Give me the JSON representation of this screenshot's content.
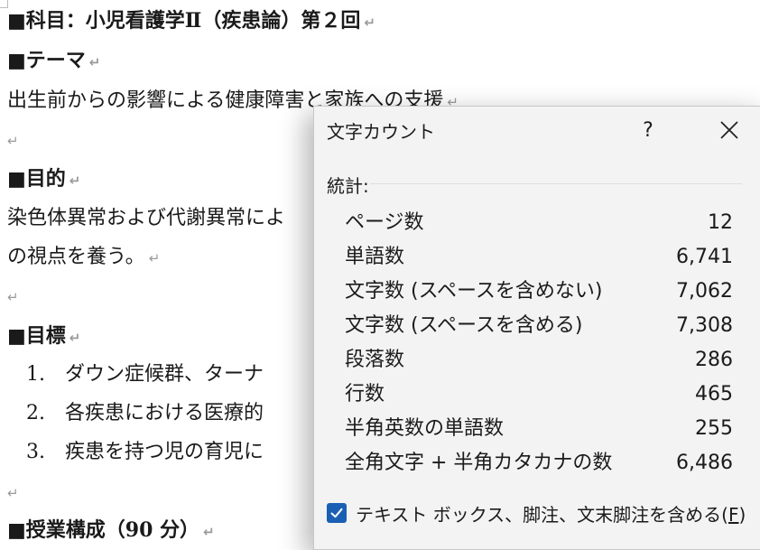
{
  "document": {
    "subject_heading": "■科目：小児看護学Ⅱ（疾患論）第２回",
    "theme_heading": "■テーマ",
    "theme_text": "出生前からの影響による健康障害と家族への支援",
    "purpose_heading": "■目的",
    "purpose_text_1": "染色体異常および代謝異常によ",
    "purpose_text_2": "の視点を養う。",
    "goals_heading": "■目標",
    "goals": [
      {
        "num": "1.",
        "text": "ダウン症候群、ターナ"
      },
      {
        "num": "2.",
        "text": "各疾患における医療的"
      },
      {
        "num": "3.",
        "text": "疾患を持つ児の育児に"
      }
    ],
    "structure_heading": "■授業構成（90 分）",
    "paragraph_mark": "↵"
  },
  "dialog": {
    "title": "文字カウント",
    "help_label": "?",
    "section_label": "統計:",
    "stats": [
      {
        "label": "ページ数",
        "value": "12"
      },
      {
        "label": "単語数",
        "value": "6,741"
      },
      {
        "label": "文字数 (スペースを含めない)",
        "value": "7,062"
      },
      {
        "label": "文字数 (スペースを含める)",
        "value": "7,308"
      },
      {
        "label": "段落数",
        "value": "286"
      },
      {
        "label": "行数",
        "value": "465"
      },
      {
        "label": "半角英数の単語数",
        "value": "255"
      },
      {
        "label": "全角文字 + 半角カタカナの数",
        "value": "6,486"
      }
    ],
    "checkbox_label": "テキスト ボックス、脚注、文末脚注を含める(",
    "checkbox_accel": "F",
    "checkbox_close": ")",
    "checkbox_checked": true
  },
  "colors": {
    "accent": "#1a5fb4",
    "dialog_bg": "#f3f3f3"
  }
}
